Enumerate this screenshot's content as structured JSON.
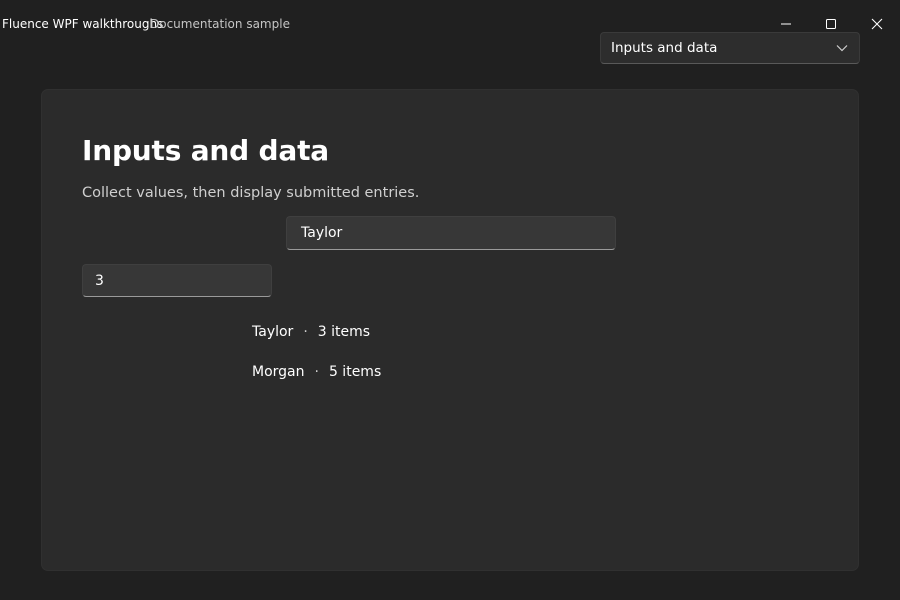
{
  "titlebar": {
    "app_title": "Fluence WPF walkthroughs",
    "subtitle": "Documentation sample",
    "buttons": [
      "minimize-icon",
      "maximize-icon",
      "close-icon"
    ]
  },
  "page_selector": {
    "selected": "Inputs and data",
    "icon": "chevron-down-icon"
  },
  "main": {
    "title": "Inputs and data",
    "description": "Collect values, then display submitted entries.",
    "name_input": {
      "value": "Taylor"
    },
    "quantity_input": {
      "value": "3"
    },
    "entries": [
      {
        "name": "Taylor",
        "separator": "·",
        "count": "3 items"
      },
      {
        "name": "Morgan",
        "separator": "·",
        "count": "5 items"
      }
    ]
  },
  "colors": {
    "window_bg": "#202020",
    "card_bg": "#2b2b2b",
    "input_bg": "#373737",
    "text_primary": "#ffffff",
    "text_secondary": "#cfcfcf"
  }
}
